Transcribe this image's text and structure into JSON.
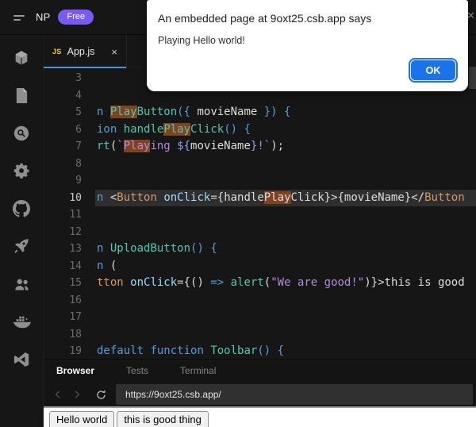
{
  "header": {
    "project_name": "NP",
    "plan_badge": "Free"
  },
  "dialog": {
    "title": "An embedded page at 9oxt25.csb.app says",
    "message": "Playing Hello world!",
    "ok_label": "OK"
  },
  "sidebar": {
    "icons": [
      "box",
      "file",
      "search",
      "gear",
      "github",
      "rocket",
      "users",
      "docker",
      "vscode"
    ]
  },
  "editor": {
    "tab_icon": "JS",
    "tab_label": "App.js",
    "tab_close": "×",
    "active_line": 10,
    "lines": [
      {
        "n": 3,
        "t": []
      },
      {
        "n": 4,
        "t": []
      },
      {
        "n": 5,
        "t": [
          {
            "s": "n",
            "c": "kw"
          },
          {
            "s": " ",
            "c": "pl"
          },
          {
            "s": "Play",
            "c": "fn",
            "h": true
          },
          {
            "s": "Button",
            "c": "fn"
          },
          {
            "s": "({ ",
            "c": "pun"
          },
          {
            "s": "movieName",
            "c": "pl"
          },
          {
            "s": " }) {",
            "c": "pun"
          }
        ]
      },
      {
        "n": 6,
        "t": [
          {
            "s": "ion",
            "c": "kw"
          },
          {
            "s": " ",
            "c": "pl"
          },
          {
            "s": "handle",
            "c": "fn"
          },
          {
            "s": "Play",
            "c": "fn",
            "h": true
          },
          {
            "s": "Click",
            "c": "fn"
          },
          {
            "s": "() {",
            "c": "pun"
          }
        ]
      },
      {
        "n": 7,
        "t": [
          {
            "s": "rt",
            "c": "fn"
          },
          {
            "s": "(",
            "c": "pl"
          },
          {
            "s": "`",
            "c": "str"
          },
          {
            "s": "Play",
            "c": "str",
            "h": true
          },
          {
            "s": "ing ",
            "c": "str"
          },
          {
            "s": "${",
            "c": "tpl"
          },
          {
            "s": "movieName",
            "c": "pl"
          },
          {
            "s": "}",
            "c": "tpl"
          },
          {
            "s": "!`",
            "c": "str"
          },
          {
            "s": ");",
            "c": "pl"
          }
        ]
      },
      {
        "n": 8,
        "t": []
      },
      {
        "n": 9,
        "t": []
      },
      {
        "n": 10,
        "t": [
          {
            "s": "n",
            "c": "kw"
          },
          {
            "s": " <",
            "c": "pl"
          },
          {
            "s": "Button",
            "c": "tag"
          },
          {
            "s": " ",
            "c": "pl"
          },
          {
            "s": "onClick",
            "c": "attr"
          },
          {
            "s": "=",
            "c": "op"
          },
          {
            "s": "{handle",
            "c": "pl"
          },
          {
            "s": "Play",
            "c": "pl",
            "h": true
          },
          {
            "s": "Click}>{movieName}</",
            "c": "pl"
          },
          {
            "s": "Button",
            "c": "tag"
          }
        ]
      },
      {
        "n": 11,
        "t": []
      },
      {
        "n": 12,
        "t": []
      },
      {
        "n": 13,
        "t": [
          {
            "s": "n",
            "c": "kw"
          },
          {
            "s": " ",
            "c": "pl"
          },
          {
            "s": "UploadButton",
            "c": "fn"
          },
          {
            "s": "() {",
            "c": "pun"
          }
        ]
      },
      {
        "n": 14,
        "t": [
          {
            "s": "n",
            "c": "kw"
          },
          {
            "s": " (",
            "c": "pl"
          }
        ]
      },
      {
        "n": 15,
        "t": [
          {
            "s": "tton",
            "c": "tag"
          },
          {
            "s": " ",
            "c": "pl"
          },
          {
            "s": "onClick",
            "c": "attr"
          },
          {
            "s": "=",
            "c": "op"
          },
          {
            "s": "{() ",
            "c": "pl"
          },
          {
            "s": "=>",
            "c": "kw"
          },
          {
            "s": " ",
            "c": "pl"
          },
          {
            "s": "alert",
            "c": "fn"
          },
          {
            "s": "(",
            "c": "pl"
          },
          {
            "s": "\"We are good!\"",
            "c": "str"
          },
          {
            "s": ")}>this is good",
            "c": "pl"
          }
        ]
      },
      {
        "n": 16,
        "t": []
      },
      {
        "n": 17,
        "t": []
      },
      {
        "n": 18,
        "t": []
      },
      {
        "n": 19,
        "t": [
          {
            "s": "default",
            "c": "kw"
          },
          {
            "s": " ",
            "c": "pl"
          },
          {
            "s": "function",
            "c": "kw"
          },
          {
            "s": " ",
            "c": "pl"
          },
          {
            "s": "Toolbar",
            "c": "fn"
          },
          {
            "s": "() {",
            "c": "pun"
          }
        ]
      }
    ]
  },
  "panel": {
    "tabs": [
      {
        "label": "Browser",
        "active": true
      },
      {
        "label": "Tests",
        "active": false
      },
      {
        "label": "Terminal",
        "active": false
      }
    ],
    "url": "https://9oxt25.csb.app/"
  },
  "preview": {
    "buttons": [
      "Hello world",
      "this is good thing"
    ]
  },
  "colors": {
    "accent_blue": "#1a73e8",
    "badge_purple": "#7a5af5",
    "tab_underline": "#4597d8",
    "match_highlight": "#83421f"
  }
}
